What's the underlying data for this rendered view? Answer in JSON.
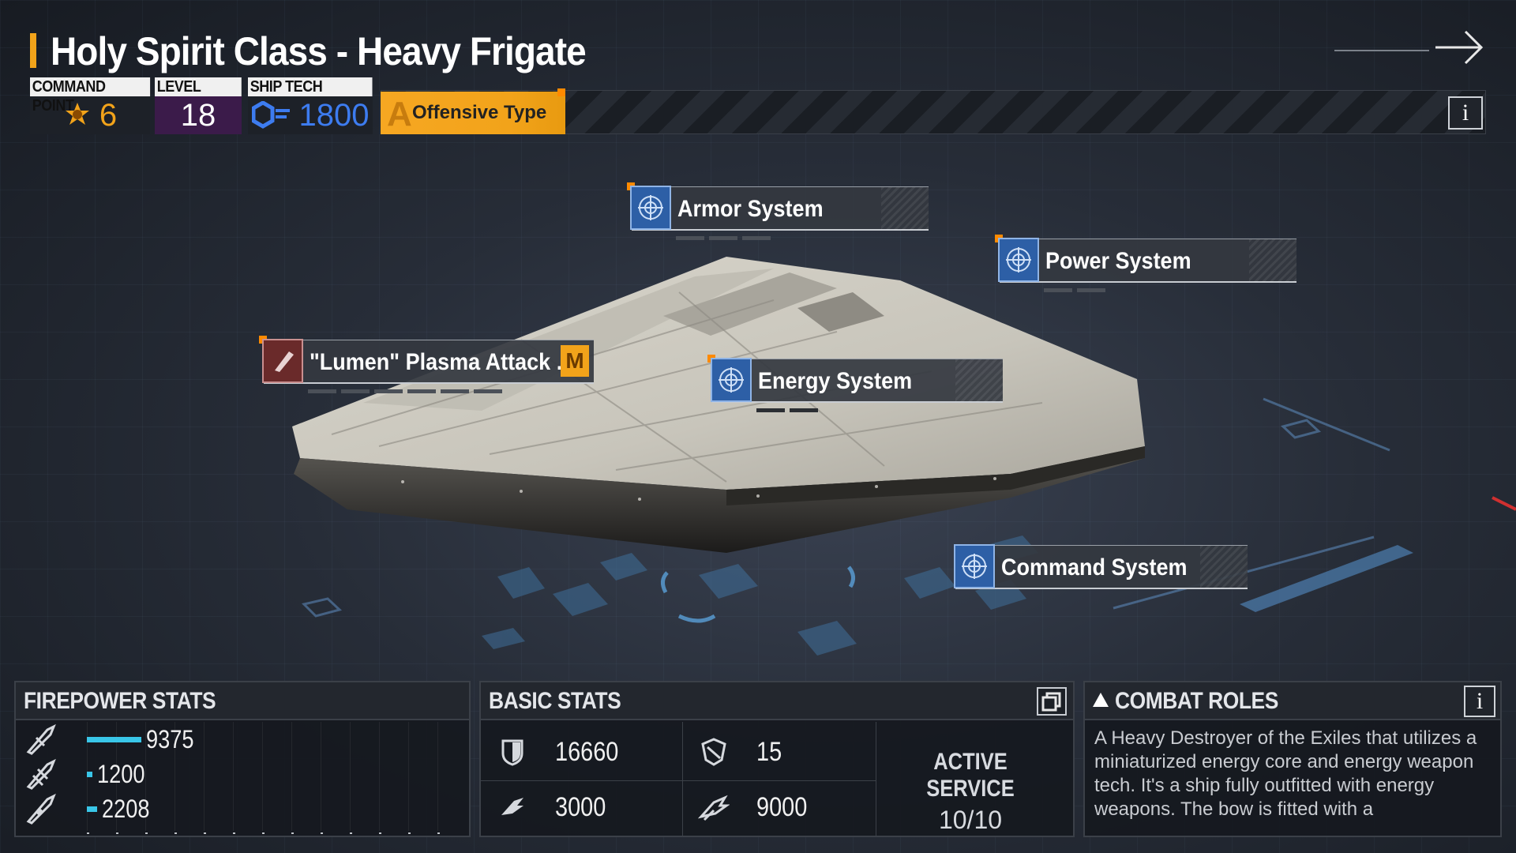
{
  "header": {
    "title": "Holy Spirit Class - Heavy Frigate",
    "command_point": {
      "label": "COMMAND POINT",
      "value": "6"
    },
    "level": {
      "label": "LEVEL",
      "value": "18"
    },
    "ship_tech": {
      "label": "SHIP TECH",
      "value": "1800"
    },
    "type_label": "Offensive Type",
    "info_glyph": "i"
  },
  "systems": {
    "armor": {
      "label": "Armor System"
    },
    "power": {
      "label": "Power System"
    },
    "weapon": {
      "label": "\"Lumen\" Plasma Attack ...",
      "badge": "M"
    },
    "energy": {
      "label": "Energy System"
    },
    "command": {
      "label": "Command System"
    }
  },
  "firepower": {
    "title": "FIREPOWER STATS",
    "rows": [
      {
        "value": "9375",
        "level": 0.21
      },
      {
        "value": "1200",
        "level": 0.02
      },
      {
        "value": "2208",
        "level": 0.04
      }
    ]
  },
  "basic_stats": {
    "title": "BASIC STATS",
    "hp": "16660",
    "shield": "15",
    "attack": "3000",
    "speed": "9000",
    "active_service_label": "ACTIVE SERVICE",
    "active_service_value": "10/10"
  },
  "combat_roles": {
    "title": "COMBAT ROLES",
    "info_glyph": "i",
    "text": "A Heavy Destroyer of the Exiles that utilizes a miniaturized energy core and energy weapon tech. It's a ship fully outfitted with energy weapons. The bow is fitted with a"
  },
  "colors": {
    "accent": "#f2a31a",
    "tech_blue": "#3d7cf0",
    "level_purple": "#3b1b4a",
    "bar_cyan": "#39c6e8",
    "system_icon_blue": "#2d5fa6"
  },
  "icons": {
    "command_point": "command-point-icon",
    "ship_tech": "ship-tech-icon",
    "system": "crosshair-icon",
    "weapon": "weapon-icon",
    "next": "arrow-right-icon",
    "copy": "copy-icon"
  }
}
